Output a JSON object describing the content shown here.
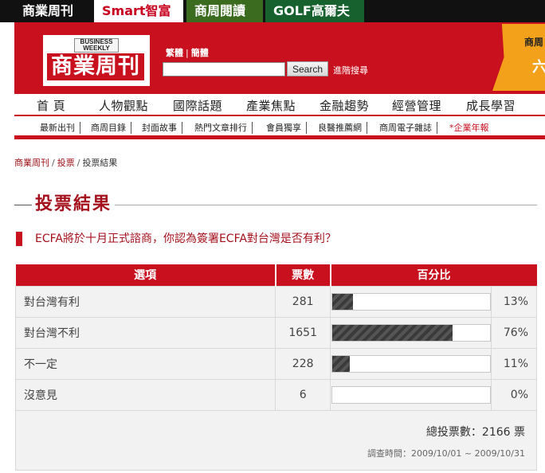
{
  "topbar": {
    "tabs": [
      {
        "label": "商業周刊",
        "sup": ""
      },
      {
        "label": "Smart智富",
        "sup": "*"
      },
      {
        "label": "商周閱讀",
        "sup": "*"
      },
      {
        "label": "GOLF高爾夫",
        "sup": "*"
      }
    ]
  },
  "header": {
    "logo_en": "BUSINESS WEEKLY",
    "logo_cn": "商業周刊",
    "lang_traditional": "繁體",
    "lang_simplified": "簡體",
    "search_placeholder": "",
    "search_button": "Search",
    "advanced_search": "進階搜尋",
    "promo_line1": "商周",
    "promo_line2": "六"
  },
  "main_nav": [
    "首 頁",
    "人物觀點",
    "國際話題",
    "產業焦點",
    "金融趨勢",
    "經營管理",
    "成長學習"
  ],
  "sub_nav": [
    "最新出刊",
    "商周目錄",
    "封面故事",
    "熱門文章排行",
    "會員獨享",
    "良醫推薦網",
    "商周電子雜誌",
    "*企業年報"
  ],
  "breadcrumb": [
    "商業周刊",
    "投票",
    "投票結果"
  ],
  "page_title": "投票結果",
  "question": "ECFA將於十月正式諮商，你認為簽署ECFA對台灣是否有利？",
  "table": {
    "headers": {
      "option": "選項",
      "votes": "票數",
      "percent": "百分比"
    },
    "rows": [
      {
        "option": "對台灣有利",
        "votes": "281",
        "percent": "13%",
        "fraction": 0.13
      },
      {
        "option": "對台灣不利",
        "votes": "1651",
        "percent": "76%",
        "fraction": 0.76
      },
      {
        "option": "不一定",
        "votes": "228",
        "percent": "11%",
        "fraction": 0.11
      },
      {
        "option": "沒意見",
        "votes": "6",
        "percent": "0%",
        "fraction": 0.0
      }
    ]
  },
  "summary": {
    "total": "總投票數：2166 票",
    "period": "調查時間：2009/10/01 ~ 2009/10/31"
  },
  "colors": {
    "brand_red": "#c8101e",
    "dark_red": "#a4101c"
  }
}
